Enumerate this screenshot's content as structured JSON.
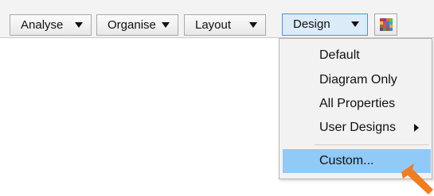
{
  "toolbar": {
    "buttons": [
      {
        "label": "Analyse"
      },
      {
        "label": "Organise"
      },
      {
        "label": "Layout"
      },
      {
        "label": "Design"
      }
    ]
  },
  "menu": {
    "items": [
      {
        "label": "Default"
      },
      {
        "label": "Diagram Only"
      },
      {
        "label": "All Properties"
      },
      {
        "label": "User Designs"
      },
      {
        "label": "Custom..."
      }
    ]
  },
  "colors": {
    "highlight": "#91c9f7",
    "active_border": "#4d93d6",
    "pointer": "#f07d1e"
  },
  "icons": {
    "palette": "color-palette-icon",
    "crosshair": "crosshair-icon",
    "pointer": "orange-arrow-pointer-icon"
  }
}
